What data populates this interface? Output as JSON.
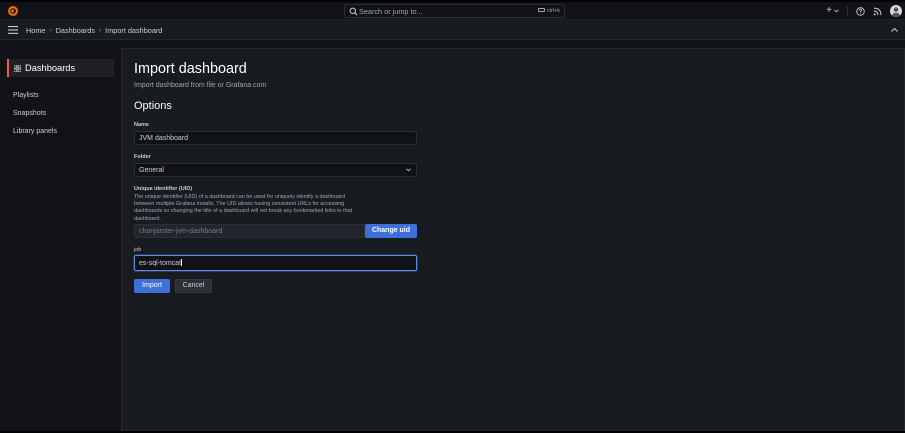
{
  "topbar": {
    "search_placeholder": "Search or jump to...",
    "search_shortcut": "ctrl+k",
    "new_label": "+"
  },
  "breadcrumb": {
    "items": [
      "Home",
      "Dashboards",
      "Import dashboard"
    ]
  },
  "sidebar": {
    "section_title": "Dashboards",
    "items": [
      {
        "label": "Playlists"
      },
      {
        "label": "Snapshots"
      },
      {
        "label": "Library panels"
      }
    ]
  },
  "page": {
    "title": "Import dashboard",
    "subtitle": "Import dashboard from file or Grafana.com",
    "options_title": "Options"
  },
  "form": {
    "name_label": "Name",
    "name_value": "JVM dashboard",
    "folder_label": "Folder",
    "folder_value": "General",
    "uid_label": "Unique identifier (UID)",
    "uid_description": "The unique identifier (UID) of a dashboard can be used for uniquely identify a dashboard between multiple Grafana installs. The UID allows having consistent URLs for accessing dashboards so changing the title of a dashboard will not break any bookmarked links to that dashboard.",
    "uid_value": "chanjarster-jvm-dashboard",
    "change_uid_label": "Change uid",
    "job_label": "job",
    "job_value": "es-sql-tomcat",
    "import_label": "Import",
    "cancel_label": "Cancel"
  },
  "colors": {
    "accent": "#3d71d9",
    "brand": "#f55f3e",
    "background": "#111217",
    "panel": "#181b1f"
  }
}
